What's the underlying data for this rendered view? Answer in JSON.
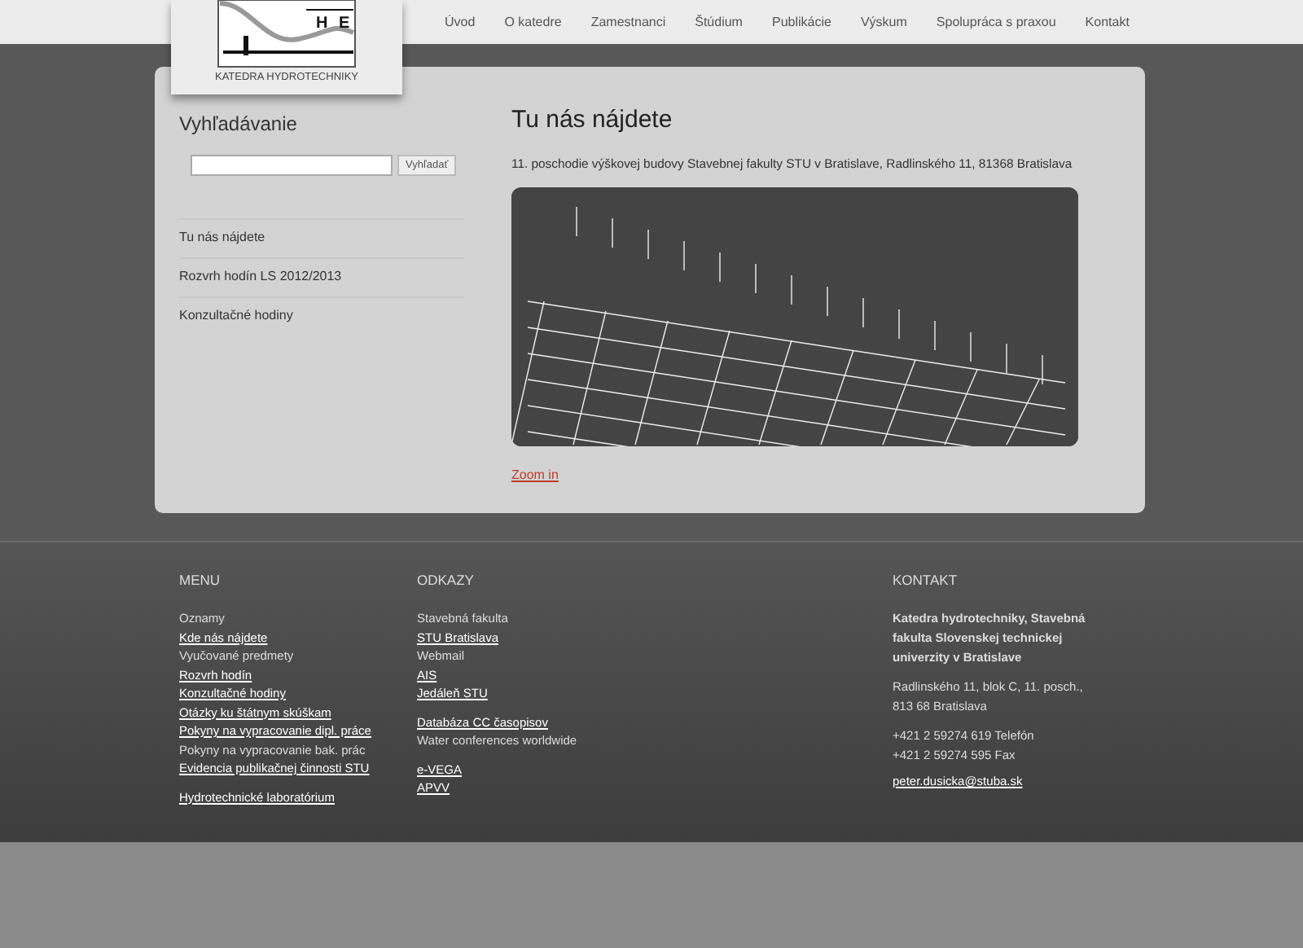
{
  "logo": {
    "letters": [
      "H",
      "E"
    ],
    "caption": "KATEDRA HYDROTECHNIKY"
  },
  "nav": [
    {
      "label": "Úvod"
    },
    {
      "label": "O katedre"
    },
    {
      "label": "Zamestnanci"
    },
    {
      "label": "Štúdium"
    },
    {
      "label": "Publikácie"
    },
    {
      "label": "Výskum"
    },
    {
      "label": "Spolupráca s praxou"
    },
    {
      "label": "Kontakt"
    }
  ],
  "sidebar": {
    "title": "Vyhľadávanie",
    "search_button": "Vyhľadať",
    "items": [
      {
        "label": "Tu nás nájdete"
      },
      {
        "label": "Rozvrh hodín LS 2012/2013"
      },
      {
        "label": "Konzultačné hodiny"
      }
    ]
  },
  "content": {
    "title": "Tu nás nájdete",
    "text": "11. poschodie výškovej budovy Stavebnej fakulty STU v Bratislave, Radlinského 11, 81368 Bratislava",
    "zoom_link": "Zoom in"
  },
  "footer": {
    "menu": {
      "title": "MENU",
      "groups": [
        [
          {
            "label": "Oznamy",
            "kind": "text"
          },
          {
            "label": "Kde nás nájdete",
            "kind": "link"
          },
          {
            "label": "Vyučované predmety",
            "kind": "text"
          },
          {
            "label": "Rozvrh hodín",
            "kind": "link"
          },
          {
            "label": "Konzultačné hodiny",
            "kind": "link"
          },
          {
            "label": "Otázky ku štátnym skúškam",
            "kind": "link"
          },
          {
            "label": "Pokyny na vypracovanie dipl. práce",
            "kind": "link"
          },
          {
            "label": "Pokyny na vypracovanie bak. prác",
            "kind": "text"
          },
          {
            "label": "Evidencia publikačnej činnosti STU",
            "kind": "link"
          }
        ],
        [
          {
            "label": "Hydrotechnické laboratórium",
            "kind": "link"
          }
        ]
      ]
    },
    "links": {
      "title": "ODKAZY",
      "groups": [
        [
          {
            "label": "Stavebná fakulta",
            "kind": "text"
          },
          {
            "label": "STU Bratislava",
            "kind": "link"
          },
          {
            "label": "Webmail",
            "kind": "text"
          },
          {
            "label": "AIS",
            "kind": "link"
          },
          {
            "label": "Jedáleň STU",
            "kind": "link"
          }
        ],
        [
          {
            "label": "Databáza CC časopisov",
            "kind": "link"
          },
          {
            "label": "Water conferences worldwide",
            "kind": "text"
          }
        ],
        [
          {
            "label": "e-VEGA",
            "kind": "link"
          },
          {
            "label": "APVV",
            "kind": "link"
          }
        ]
      ]
    },
    "contact": {
      "title": "KONTAKT",
      "name": "Katedra hydrotechniky, Stavebná fakulta Slovenskej technickej univerzity v Bratislave",
      "address": [
        "Radlinského 11, blok C, 11. posch.,",
        "813 68 Bratislava"
      ],
      "phones": [
        "+421 2 59274 619 Telefón",
        "+421 2 59274 595 Fax"
      ],
      "email": "peter.dusicka@stuba.sk"
    }
  }
}
